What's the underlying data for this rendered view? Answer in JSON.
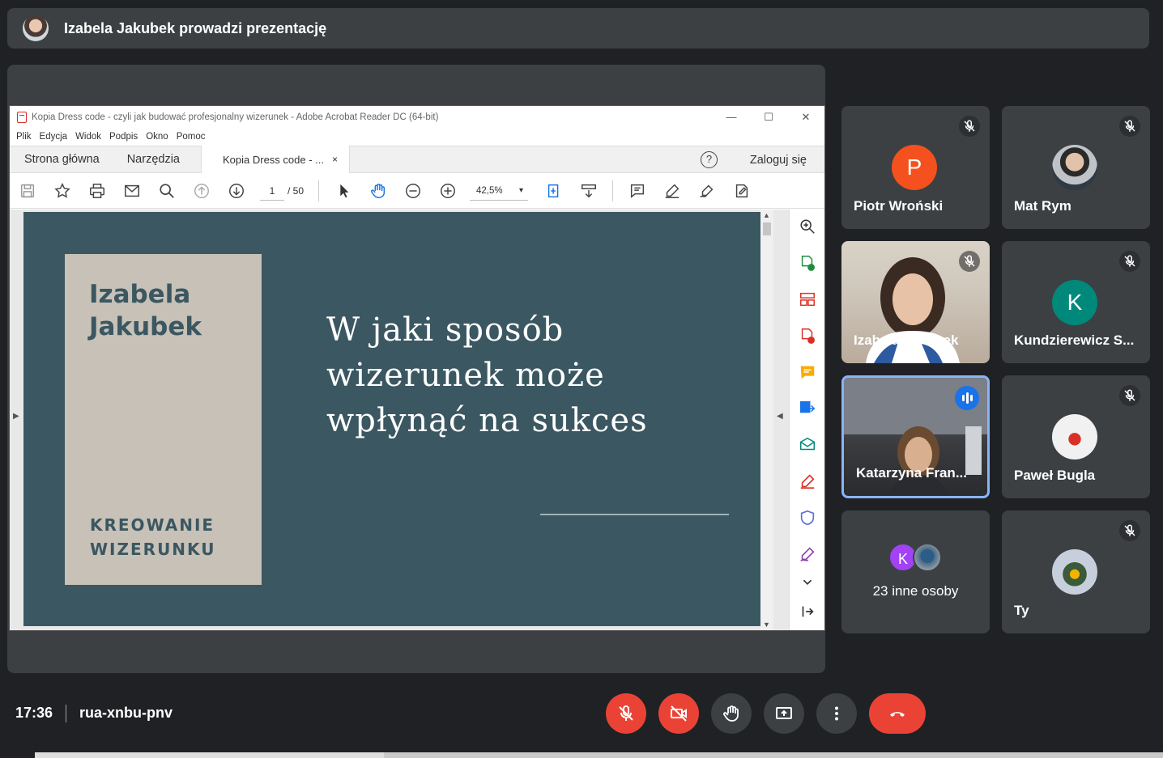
{
  "topbar": {
    "title": "Izabela Jakubek prowadzi prezentację"
  },
  "acrobat": {
    "window_title": "Kopia Dress code - czyli jak budować profesjonalny wizerunek - Adobe Acrobat Reader DC (64-bit)",
    "window_controls": {
      "minimize": "—",
      "maximize": "☐",
      "close": "✕"
    },
    "menu": [
      "Plik",
      "Edycja",
      "Widok",
      "Podpis",
      "Okno",
      "Pomoc"
    ],
    "tabs": {
      "home": "Strona główna",
      "tools": "Narzędzia",
      "document": "Kopia Dress code - ...",
      "close": "×"
    },
    "help": "?",
    "login": "Zaloguj się",
    "toolbar": {
      "page_current": "1",
      "page_total": "/ 50",
      "zoom": "42,5%"
    }
  },
  "slide": {
    "name_line1": "Izabela",
    "name_line2": "Jakubek",
    "sub_line1": "KREOWANIE",
    "sub_line2": "WIZERUNKU",
    "heading_line1": "W jaki sposób",
    "heading_line2": "wizerunek może",
    "heading_line3": "wpłynąć na sukces",
    "colors": {
      "background": "#3b5761",
      "card": "#c8c1b7"
    }
  },
  "participants": [
    {
      "name": "Piotr Wroński",
      "avatar_letter": "P",
      "avatar_color": "#f4511e",
      "muted": true
    },
    {
      "name": "Mat Rym",
      "avatar": "photo",
      "muted": true
    },
    {
      "name": "Izabela Jakubek",
      "video": true,
      "muted": true
    },
    {
      "name": "Kundzierewicz S...",
      "avatar_letter": "K",
      "avatar_color": "#00897b",
      "muted": true
    },
    {
      "name": "Katarzyna Fran...",
      "video": true,
      "speaking": true
    },
    {
      "name": "Paweł Bugla",
      "avatar": "photo",
      "muted": true
    },
    {
      "name": "23 inne osoby",
      "avatar_letter": "K",
      "avatar_color": "#a142f4"
    },
    {
      "name": "Ty",
      "avatar": "photo",
      "muted": true
    }
  ],
  "bottombar": {
    "time": "17:36",
    "meeting_code": "rua-xnbu-pnv"
  },
  "colors": {
    "accent_red": "#ea4335",
    "speaking_blue": "#1a73e8",
    "tile_bg": "#3c4043",
    "page_bg": "#202124"
  }
}
